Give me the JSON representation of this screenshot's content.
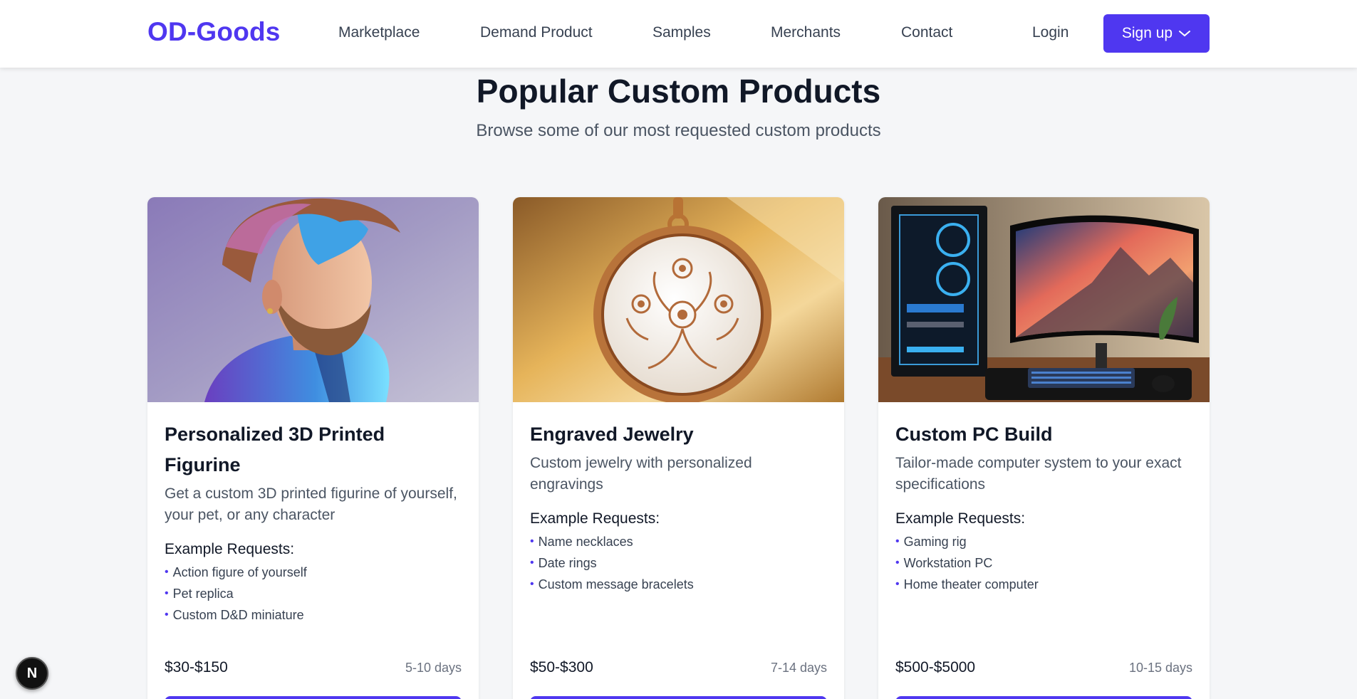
{
  "header": {
    "logo": "OD-Goods",
    "nav": {
      "marketplace": "Marketplace",
      "demand_product": "Demand Product",
      "samples": "Samples",
      "merchants": "Merchants",
      "contact": "Contact"
    },
    "login": "Login",
    "signup": "Sign up"
  },
  "section": {
    "title": "Popular Custom Products",
    "subtitle": "Browse some of our most requested custom products"
  },
  "products": [
    {
      "title": "Personalized 3D Printed Figurine",
      "description": "Get a custom 3D printed figurine of yourself, your pet, or any character",
      "examples_heading": "Example Requests:",
      "examples": [
        "Action figure of yourself",
        "Pet replica",
        "Custom D&D miniature"
      ],
      "price": "$30-$150",
      "duration": "5-10 days"
    },
    {
      "title": "Engraved Jewelry",
      "description": "Custom jewelry with personalized engravings",
      "examples_heading": "Example Requests:",
      "examples": [
        "Name necklaces",
        "Date rings",
        "Custom message bracelets"
      ],
      "price": "$50-$300",
      "duration": "7-14 days"
    },
    {
      "title": "Custom PC Build",
      "description": "Tailor-made computer system to your exact specifications",
      "examples_heading": "Example Requests:",
      "examples": [
        "Gaming rig",
        "Workstation PC",
        "Home theater computer"
      ],
      "price": "$500-$5000",
      "duration": "10-15 days"
    }
  ],
  "dev_badge": {
    "letter": "N"
  },
  "colors": {
    "brand": "#4f37f0",
    "page_background": "#f5f6f8"
  }
}
